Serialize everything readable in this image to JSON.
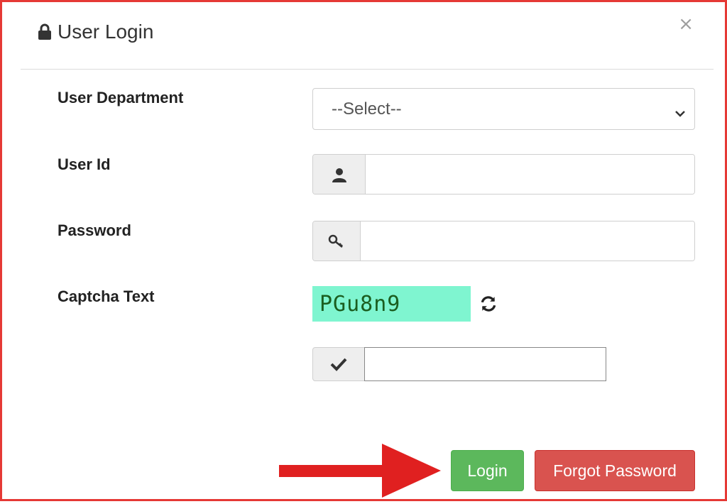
{
  "dialog": {
    "title": "User Login",
    "close_symbol": "×",
    "icon": "lock-icon"
  },
  "form": {
    "department": {
      "label": "User Department",
      "selected": "--Select--"
    },
    "user_id": {
      "label": "User Id",
      "value": "",
      "icon": "user-icon"
    },
    "password": {
      "label": "Password",
      "value": "",
      "icon": "key-icon"
    },
    "captcha": {
      "label": "Captcha Text",
      "text": "PGu8n9",
      "refresh_icon": "refresh-icon",
      "input_value": "",
      "input_icon": "check-icon"
    }
  },
  "buttons": {
    "login": "Login",
    "forgot": "Forgot Password"
  },
  "colors": {
    "login": "#5cb85c",
    "forgot": "#d9534f",
    "captcha_bg": "#7ff5d0",
    "captcha_text": "#1b5e20",
    "frame_border": "#e53935",
    "arrow": "#e02020"
  },
  "annotation": {
    "arrow_icon": "red-arrow-icon"
  }
}
